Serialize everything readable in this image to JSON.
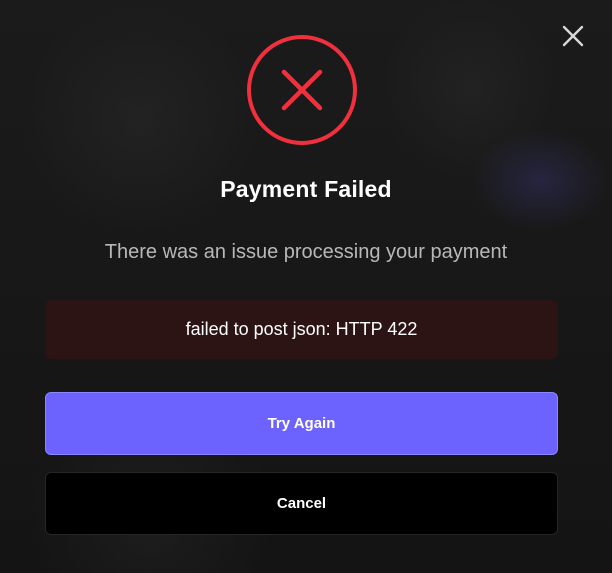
{
  "dialog": {
    "title": "Payment Failed",
    "subtitle": "There was an issue processing your payment",
    "error_message": "failed to post json: HTTP 422",
    "primary_button_label": "Try Again",
    "secondary_button_label": "Cancel"
  },
  "icons": {
    "close": "close-icon",
    "status": "error-x-icon"
  },
  "colors": {
    "error_red": "#f0303c",
    "primary_button": "#6c63ff",
    "error_box_bg": "#2d1414",
    "background": "#161616"
  }
}
